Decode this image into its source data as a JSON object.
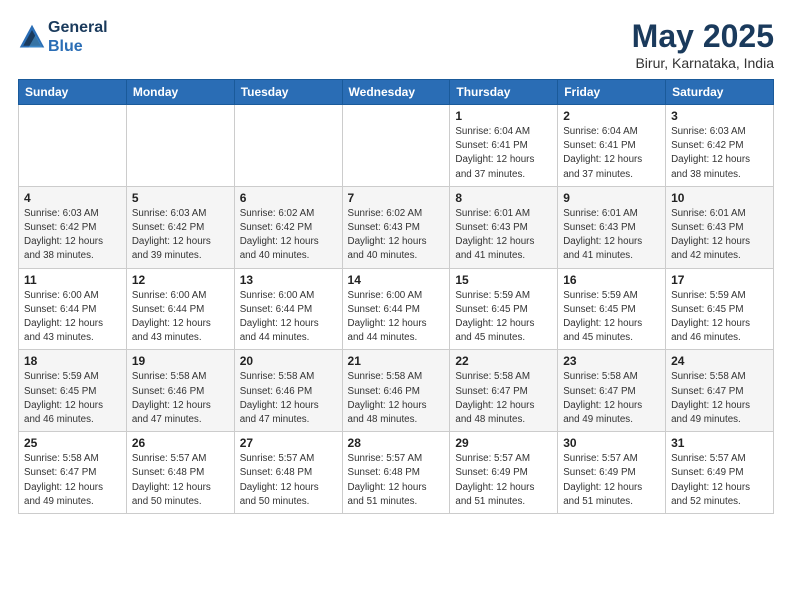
{
  "header": {
    "logo_line1": "General",
    "logo_line2": "Blue",
    "month": "May 2025",
    "location": "Birur, Karnataka, India"
  },
  "days_of_week": [
    "Sunday",
    "Monday",
    "Tuesday",
    "Wednesday",
    "Thursday",
    "Friday",
    "Saturday"
  ],
  "weeks": [
    [
      {
        "day": "",
        "info": ""
      },
      {
        "day": "",
        "info": ""
      },
      {
        "day": "",
        "info": ""
      },
      {
        "day": "",
        "info": ""
      },
      {
        "day": "1",
        "info": "Sunrise: 6:04 AM\nSunset: 6:41 PM\nDaylight: 12 hours\nand 37 minutes."
      },
      {
        "day": "2",
        "info": "Sunrise: 6:04 AM\nSunset: 6:41 PM\nDaylight: 12 hours\nand 37 minutes."
      },
      {
        "day": "3",
        "info": "Sunrise: 6:03 AM\nSunset: 6:42 PM\nDaylight: 12 hours\nand 38 minutes."
      }
    ],
    [
      {
        "day": "4",
        "info": "Sunrise: 6:03 AM\nSunset: 6:42 PM\nDaylight: 12 hours\nand 38 minutes."
      },
      {
        "day": "5",
        "info": "Sunrise: 6:03 AM\nSunset: 6:42 PM\nDaylight: 12 hours\nand 39 minutes."
      },
      {
        "day": "6",
        "info": "Sunrise: 6:02 AM\nSunset: 6:42 PM\nDaylight: 12 hours\nand 40 minutes."
      },
      {
        "day": "7",
        "info": "Sunrise: 6:02 AM\nSunset: 6:43 PM\nDaylight: 12 hours\nand 40 minutes."
      },
      {
        "day": "8",
        "info": "Sunrise: 6:01 AM\nSunset: 6:43 PM\nDaylight: 12 hours\nand 41 minutes."
      },
      {
        "day": "9",
        "info": "Sunrise: 6:01 AM\nSunset: 6:43 PM\nDaylight: 12 hours\nand 41 minutes."
      },
      {
        "day": "10",
        "info": "Sunrise: 6:01 AM\nSunset: 6:43 PM\nDaylight: 12 hours\nand 42 minutes."
      }
    ],
    [
      {
        "day": "11",
        "info": "Sunrise: 6:00 AM\nSunset: 6:44 PM\nDaylight: 12 hours\nand 43 minutes."
      },
      {
        "day": "12",
        "info": "Sunrise: 6:00 AM\nSunset: 6:44 PM\nDaylight: 12 hours\nand 43 minutes."
      },
      {
        "day": "13",
        "info": "Sunrise: 6:00 AM\nSunset: 6:44 PM\nDaylight: 12 hours\nand 44 minutes."
      },
      {
        "day": "14",
        "info": "Sunrise: 6:00 AM\nSunset: 6:44 PM\nDaylight: 12 hours\nand 44 minutes."
      },
      {
        "day": "15",
        "info": "Sunrise: 5:59 AM\nSunset: 6:45 PM\nDaylight: 12 hours\nand 45 minutes."
      },
      {
        "day": "16",
        "info": "Sunrise: 5:59 AM\nSunset: 6:45 PM\nDaylight: 12 hours\nand 45 minutes."
      },
      {
        "day": "17",
        "info": "Sunrise: 5:59 AM\nSunset: 6:45 PM\nDaylight: 12 hours\nand 46 minutes."
      }
    ],
    [
      {
        "day": "18",
        "info": "Sunrise: 5:59 AM\nSunset: 6:45 PM\nDaylight: 12 hours\nand 46 minutes."
      },
      {
        "day": "19",
        "info": "Sunrise: 5:58 AM\nSunset: 6:46 PM\nDaylight: 12 hours\nand 47 minutes."
      },
      {
        "day": "20",
        "info": "Sunrise: 5:58 AM\nSunset: 6:46 PM\nDaylight: 12 hours\nand 47 minutes."
      },
      {
        "day": "21",
        "info": "Sunrise: 5:58 AM\nSunset: 6:46 PM\nDaylight: 12 hours\nand 48 minutes."
      },
      {
        "day": "22",
        "info": "Sunrise: 5:58 AM\nSunset: 6:47 PM\nDaylight: 12 hours\nand 48 minutes."
      },
      {
        "day": "23",
        "info": "Sunrise: 5:58 AM\nSunset: 6:47 PM\nDaylight: 12 hours\nand 49 minutes."
      },
      {
        "day": "24",
        "info": "Sunrise: 5:58 AM\nSunset: 6:47 PM\nDaylight: 12 hours\nand 49 minutes."
      }
    ],
    [
      {
        "day": "25",
        "info": "Sunrise: 5:58 AM\nSunset: 6:47 PM\nDaylight: 12 hours\nand 49 minutes."
      },
      {
        "day": "26",
        "info": "Sunrise: 5:57 AM\nSunset: 6:48 PM\nDaylight: 12 hours\nand 50 minutes."
      },
      {
        "day": "27",
        "info": "Sunrise: 5:57 AM\nSunset: 6:48 PM\nDaylight: 12 hours\nand 50 minutes."
      },
      {
        "day": "28",
        "info": "Sunrise: 5:57 AM\nSunset: 6:48 PM\nDaylight: 12 hours\nand 51 minutes."
      },
      {
        "day": "29",
        "info": "Sunrise: 5:57 AM\nSunset: 6:49 PM\nDaylight: 12 hours\nand 51 minutes."
      },
      {
        "day": "30",
        "info": "Sunrise: 5:57 AM\nSunset: 6:49 PM\nDaylight: 12 hours\nand 51 minutes."
      },
      {
        "day": "31",
        "info": "Sunrise: 5:57 AM\nSunset: 6:49 PM\nDaylight: 12 hours\nand 52 minutes."
      }
    ]
  ]
}
